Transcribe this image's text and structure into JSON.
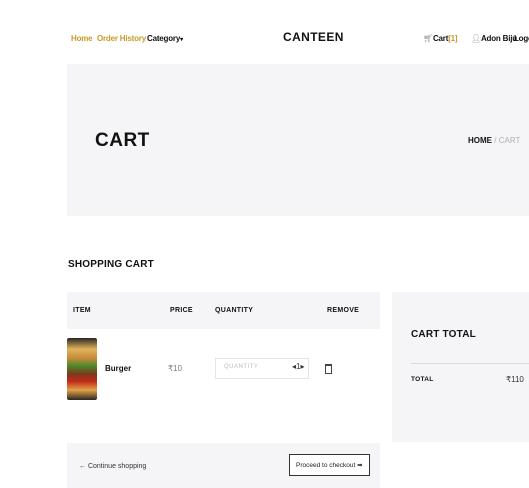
{
  "nav": {
    "home": "Home",
    "order_history": "Order History",
    "category": "Category",
    "category_caret": "▾",
    "brand": "CANTEEN",
    "cart_label": "Cart",
    "cart_count": "[1]",
    "user_name": "Adon Biju",
    "logout": "Logo"
  },
  "hero": {
    "title": "CART",
    "breadcrumb_home": "HOME",
    "breadcrumb_sep": "/",
    "breadcrumb_current": "CART"
  },
  "cart": {
    "section_title": "SHOPPING CART",
    "columns": {
      "item": "ITEM",
      "price": "PRICE",
      "quantity": "QUANTITY",
      "remove": "REMOVE"
    },
    "rows": [
      {
        "name": "Burger",
        "price": "₹10",
        "quantity_placeholder": "QUANTITY",
        "quantity_control": "◂1▸",
        "image_icon": "burger-image"
      }
    ],
    "continue_label": "← Continue shopping",
    "checkout_label": "Proceed to checkout ➡"
  },
  "totals": {
    "title": "CART TOTAL",
    "total_label": "TOTAL",
    "total_value": "₹110"
  },
  "colors": {
    "accent": "#c89a2c",
    "panel_bg": "#f5f5f7",
    "text": "#111111",
    "muted": "#7d7d82"
  }
}
